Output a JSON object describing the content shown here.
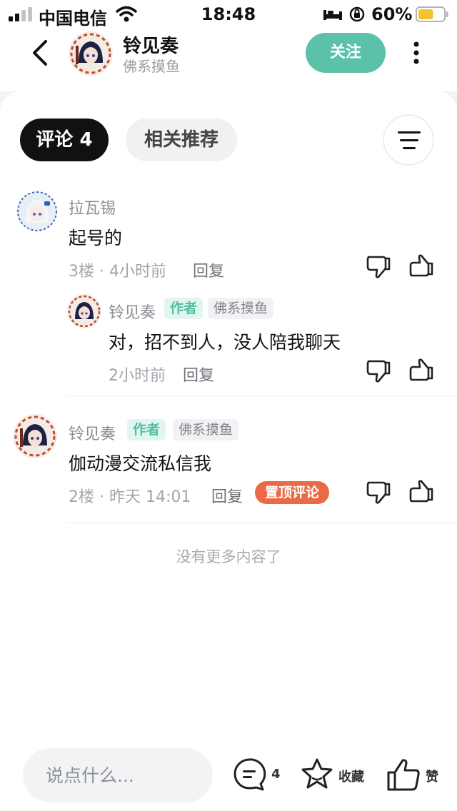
{
  "status_bar": {
    "carrier": "中国电信",
    "time": "18:48",
    "battery": "60%",
    "battery_level": 0.6
  },
  "header": {
    "name": "铃见奏",
    "subtitle": "佛系摸鱼",
    "follow_label": "关注"
  },
  "tabs": {
    "comments_label": "评论 4",
    "related_label": "相关推荐"
  },
  "comments": [
    {
      "user": "拉瓦锡",
      "text": "起号的",
      "meta": "3楼 · 4小时前",
      "reply_label": "回复",
      "replies": [
        {
          "user": "铃见奏",
          "author_tag": "作者",
          "flair": "佛系摸鱼",
          "text": "对，招不到人，没人陪我聊天",
          "meta": "2小时前",
          "reply_label": "回复"
        }
      ]
    },
    {
      "user": "铃见奏",
      "author_tag": "作者",
      "flair": "佛系摸鱼",
      "text": "伽动漫交流私信我",
      "meta": "2楼 · 昨天 14:01",
      "reply_label": "回复",
      "pinned_label": "置顶评论"
    }
  ],
  "end_text": "没有更多内容了",
  "bottom_bar": {
    "input_placeholder": "说点什么...",
    "comment_count": "4",
    "favorite_label": "收藏",
    "like_label": "赞"
  },
  "colors": {
    "accent": "#5bc1a8",
    "pinned": "#e96a44"
  }
}
